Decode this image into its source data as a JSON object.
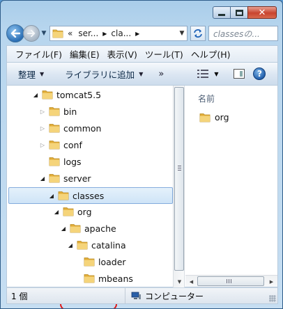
{
  "window": {
    "caption_buttons": [
      "minimize",
      "maximize",
      "close"
    ],
    "close_glyph": "✕"
  },
  "nav": {
    "overflow_chevron": "«",
    "breadcrumbs": [
      "ser...",
      "cla..."
    ],
    "search_placeholder": "classesの..."
  },
  "menu": [
    "ファイル(F)",
    "編集(E)",
    "表示(V)",
    "ツール(T)",
    "ヘルプ(H)"
  ],
  "commands": {
    "organize": "整理",
    "include_in_library": "ライブラリに追加",
    "more": "»",
    "help": "?"
  },
  "tree": {
    "items": [
      {
        "label": "tomcat5.5",
        "level": 0,
        "expander": "open"
      },
      {
        "label": "bin",
        "level": 1,
        "expander": "closed"
      },
      {
        "label": "common",
        "level": 1,
        "expander": "closed"
      },
      {
        "label": "conf",
        "level": 1,
        "expander": "closed"
      },
      {
        "label": "logs",
        "level": 1,
        "expander": "none"
      },
      {
        "label": "server",
        "level": 1,
        "expander": "open"
      },
      {
        "label": "classes",
        "level": 2,
        "expander": "open",
        "selected": true
      },
      {
        "label": "org",
        "level": 3,
        "expander": "open",
        "highlighted": true
      },
      {
        "label": "apache",
        "level": 4,
        "expander": "open"
      },
      {
        "label": "catalina",
        "level": 5,
        "expander": "open"
      },
      {
        "label": "loader",
        "level": 6,
        "expander": "none"
      },
      {
        "label": "mbeans",
        "level": 6,
        "expander": "none"
      }
    ]
  },
  "content": {
    "column_header": "名前",
    "files": [
      {
        "label": "org"
      }
    ]
  },
  "status": {
    "item_count": "1 個",
    "location": "コンピューター"
  },
  "colors": {
    "folder": "#e8b94a",
    "selection": "#cfe4f7",
    "annotation": "#e01616",
    "close_button": "#c8442e"
  }
}
